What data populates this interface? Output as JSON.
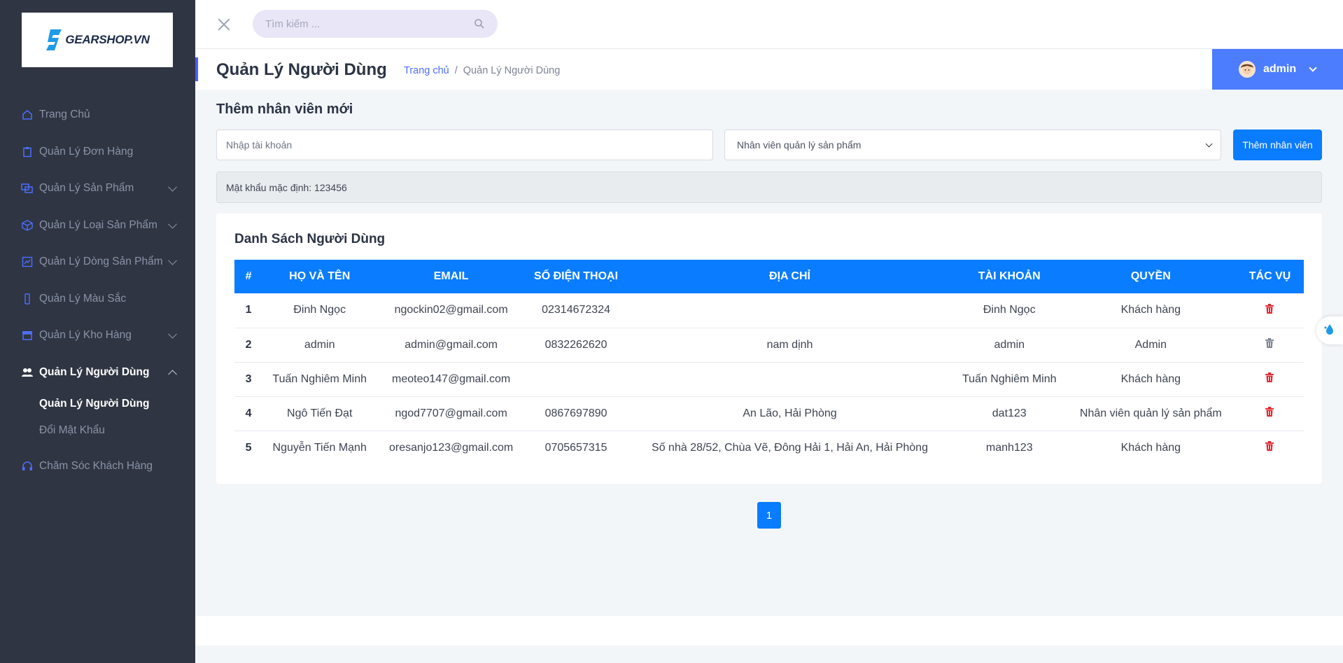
{
  "brand": {
    "logo_text": "GEARSHOP.VN"
  },
  "sidebar": {
    "items": [
      {
        "label": "Trang Chủ",
        "icon": "home-icon",
        "has_children": false
      },
      {
        "label": "Quản Lý Đơn Hàng",
        "icon": "clipboard-icon",
        "has_children": false
      },
      {
        "label": "Quản Lý Sản Phẩm",
        "icon": "products-icon",
        "has_children": true
      },
      {
        "label": "Quản Lý Loại Sản Phẩm",
        "icon": "box-icon",
        "has_children": true
      },
      {
        "label": "Quản Lý Dòng Sản Phẩm",
        "icon": "chart-icon",
        "has_children": true
      },
      {
        "label": "Quản Lý Màu Sắc",
        "icon": "phone-icon",
        "has_children": false
      },
      {
        "label": "Quản Lý Kho Hàng",
        "icon": "warehouse-icon",
        "has_children": true
      },
      {
        "label": "Quản Lý Người Dùng",
        "icon": "users-icon",
        "has_children": true,
        "active": true
      },
      {
        "label": "Chăm Sóc Khách Hàng",
        "icon": "headset-icon",
        "has_children": false
      }
    ],
    "sub_items": [
      {
        "label": "Quản Lý Người Dùng",
        "active": true
      },
      {
        "label": "Đổi Mật Khẩu",
        "active": false
      }
    ]
  },
  "topbar": {
    "search_placeholder": "Tìm kiếm ..."
  },
  "header": {
    "title": "Quản Lý Người Dùng",
    "breadcrumb": {
      "home": "Trang chủ",
      "separator": "/",
      "current": "Quản Lý Người Dùng"
    },
    "user": "admin"
  },
  "add_form": {
    "title": "Thêm nhân viên mới",
    "account_placeholder": "Nhập tài khoản",
    "role_selected": "Nhân viên quản lý sản phẩm",
    "add_button": "Thêm nhân viên",
    "password_note": "Mật khẩu mặc định: 123456"
  },
  "users_table": {
    "title": "Danh Sách Người Dùng",
    "columns": [
      "#",
      "HỌ VÀ TÊN",
      "EMAIL",
      "SỐ ĐIỆN THOẠI",
      "ĐỊA CHỈ",
      "TÀI KHOẢN",
      "QUYỀN",
      "TÁC VỤ"
    ],
    "rows": [
      [
        "1",
        "Đinh Ngọc",
        "ngockin02@gmail.com",
        "02314672324",
        "",
        "Đinh Ngọc",
        "Khách hàng"
      ],
      [
        "2",
        "admin",
        "admin@gmail.com",
        "0832262620",
        "nam dịnh",
        "admin",
        "Admin"
      ],
      [
        "3",
        "Tuấn Nghiêm Minh",
        "meoteo147@gmail.com",
        "",
        "",
        "Tuấn Nghiêm Minh",
        "Khách hàng"
      ],
      [
        "4",
        "Ngô Tiến Đạt",
        "ngod7707@gmail.com",
        "0867697890",
        "An Lão, Hải Phòng",
        "dat123",
        "Nhân viên quản lý sản phẩm"
      ],
      [
        "5",
        "Nguyễn Tiến Mạnh",
        "oresanjo123@gmail.com",
        "0705657315",
        "Số nhà 28/52, Chùa Vẽ, Đông Hải 1, Hải An, Hải Phòng",
        "manh123",
        "Khách hàng"
      ]
    ],
    "trash_colors": [
      "#e0242c",
      "#7a8290",
      "#e0242c",
      "#e0242c",
      "#e0242c"
    ]
  },
  "pagination": {
    "current": "1"
  },
  "colors": {
    "primary": "#0a7cff",
    "sidebar_bg": "#2f3542",
    "user_box": "#4c7dff",
    "danger": "#e0242c"
  }
}
